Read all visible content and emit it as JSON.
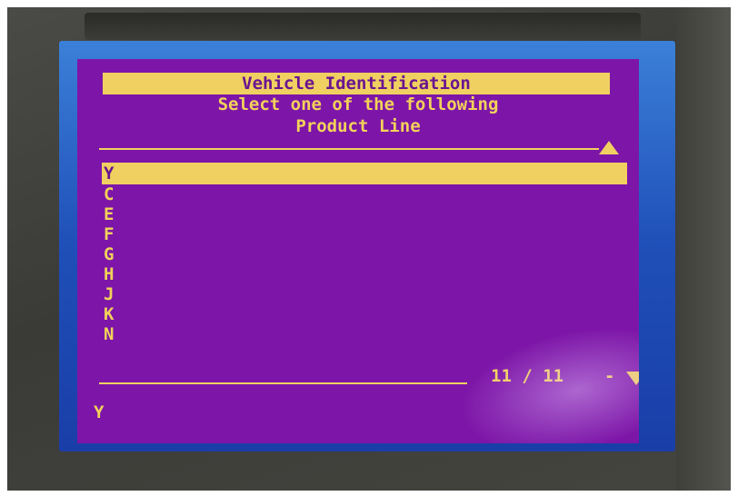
{
  "screen": {
    "title": "Vehicle Identification",
    "subtitle_line1": "Select one of the following",
    "subtitle_line2": "Product Line",
    "items": [
      {
        "label": "Y",
        "selected": true
      },
      {
        "label": "C",
        "selected": false
      },
      {
        "label": "E",
        "selected": false
      },
      {
        "label": "F",
        "selected": false
      },
      {
        "label": "G",
        "selected": false
      },
      {
        "label": "H",
        "selected": false
      },
      {
        "label": "J",
        "selected": false
      },
      {
        "label": "K",
        "selected": false
      },
      {
        "label": "N",
        "selected": false
      }
    ],
    "page_indicator": "11 / 11",
    "page_dash": "-",
    "footer_value": "Y"
  },
  "colors": {
    "screen_background": "#7d16a8",
    "text": "#f2d25a",
    "highlight": "#f0d060",
    "bezel": "#2f66cc"
  },
  "icons": {
    "scroll_up": "triangle-up-icon",
    "scroll_down": "triangle-down-icon"
  }
}
